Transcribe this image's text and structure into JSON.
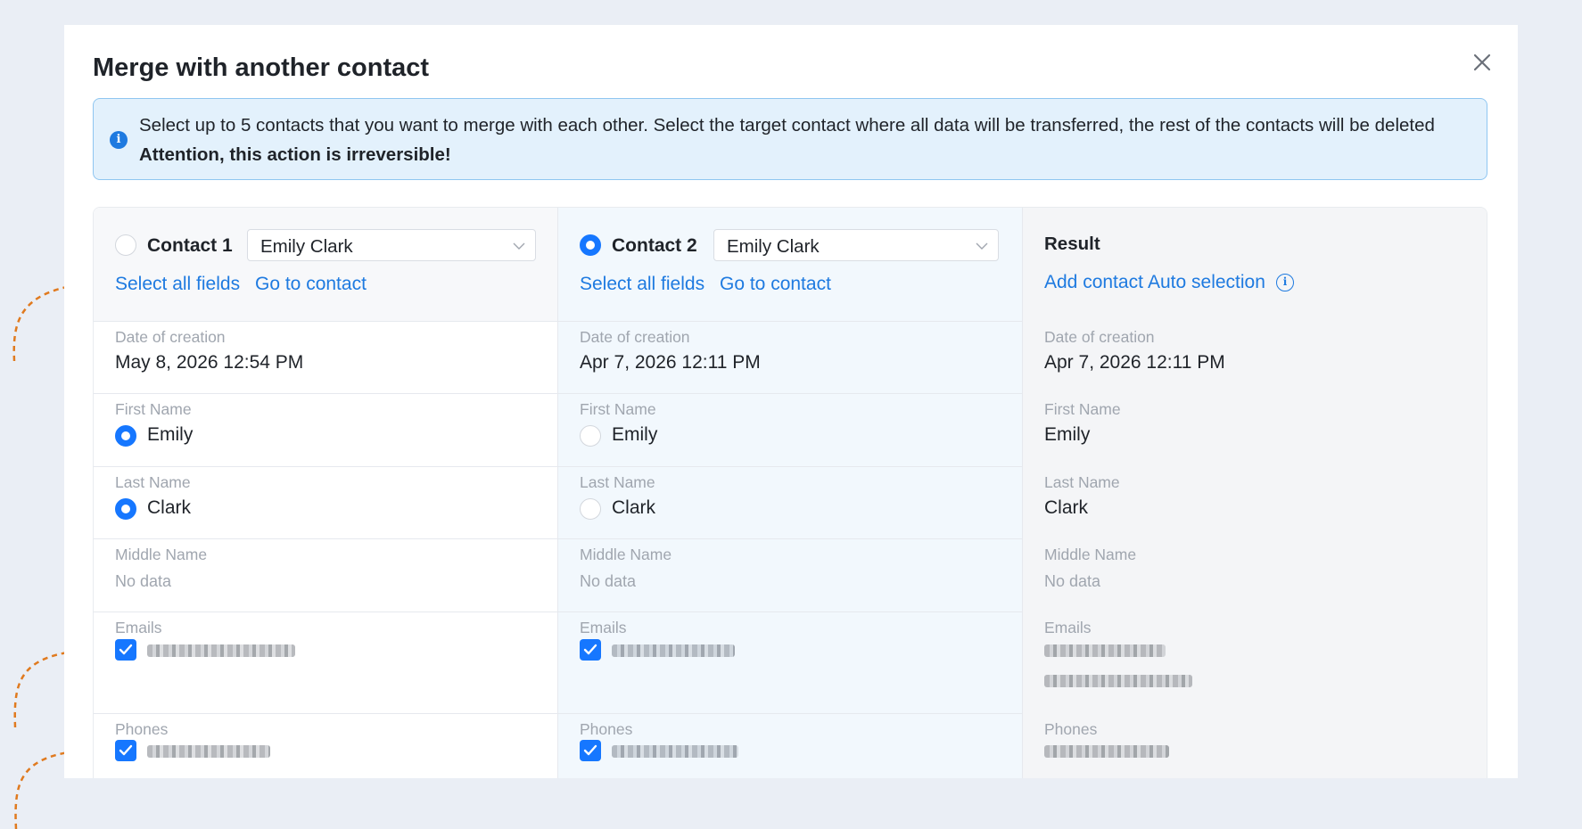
{
  "dialog": {
    "title": "Merge with another contact"
  },
  "notice": {
    "text": "Select up to 5 contacts that you want to merge with each other. Select the target contact where all data will be transferred, the rest of the contacts will be deleted",
    "warning": "Attention, this action is irreversible!"
  },
  "contacts": [
    {
      "label": "Contact 1",
      "selected": "Emily Clark",
      "is_target": false,
      "select_all": "Select all fields",
      "go_to": "Go to contact",
      "date_of_creation": "May 8, 2026 12:54 PM",
      "first_name": "Emily",
      "first_name_chosen": true,
      "last_name": "Clark",
      "last_name_chosen": true,
      "middle_name": "No data",
      "emails_checked": true,
      "phones_checked": true
    },
    {
      "label": "Contact 2",
      "selected": "Emily Clark",
      "is_target": true,
      "select_all": "Select all fields",
      "go_to": "Go to contact",
      "date_of_creation": "Apr 7, 2026 12:11 PM",
      "first_name": "Emily",
      "first_name_chosen": false,
      "last_name": "Clark",
      "last_name_chosen": false,
      "middle_name": "No data",
      "emails_checked": true,
      "phones_checked": true
    }
  ],
  "result": {
    "title": "Result",
    "add_contact": "Add contact",
    "auto_selection": "Auto selection",
    "date_of_creation": "Apr 7, 2026 12:11 PM",
    "first_name": "Emily",
    "last_name": "Clark",
    "middle_name": "No data"
  },
  "fields": {
    "date_of_creation": "Date of creation",
    "first_name": "First Name",
    "last_name": "Last Name",
    "middle_name": "Middle Name",
    "emails": "Emails",
    "phones": "Phones"
  },
  "colors": {
    "accent": "#1677ff",
    "link": "#1e7ae0",
    "notice_bg": "#e3f1fc",
    "annotation_arrow": "#e07a1f"
  },
  "icons": {
    "close": "close-icon",
    "info": "info-icon",
    "dropdown": "chevron-down-icon",
    "checkbox": "check-icon"
  }
}
